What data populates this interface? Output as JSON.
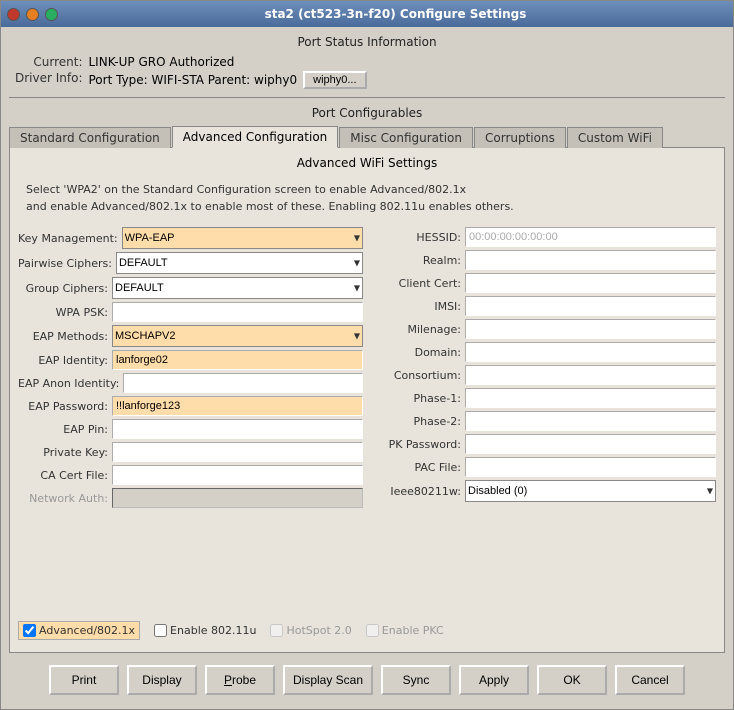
{
  "window": {
    "title": "sta2  (ct523-3n-f20) Configure Settings",
    "titlebar_buttons": [
      "close",
      "min",
      "max"
    ]
  },
  "port_status": {
    "section_title": "Port Status Information",
    "current_label": "Current:",
    "current_value": "LINK-UP GRO  Authorized",
    "driver_label": "Driver Info:",
    "driver_value": "Port Type: WIFI-STA   Parent: wiphy0",
    "wiphy_btn": "wiphy0..."
  },
  "port_configurables": {
    "section_title": "Port Configurables"
  },
  "tabs": [
    {
      "label": "Standard Configuration",
      "active": false
    },
    {
      "label": "Advanced Configuration",
      "active": true
    },
    {
      "label": "Misc Configuration",
      "active": false
    },
    {
      "label": "Corruptions",
      "active": false
    },
    {
      "label": "Custom WiFi",
      "active": false
    }
  ],
  "advanced": {
    "title": "Advanced WiFi Settings",
    "notice": "Select 'WPA2' on the Standard Configuration screen to enable Advanced/802.1x\nand enable Advanced/802.1x to enable most of these. Enabling 802.11u enables others.",
    "fields_left": [
      {
        "label": "Key Management:",
        "value": "WPA-EAP",
        "type": "select",
        "highlight": true
      },
      {
        "label": "Pairwise Ciphers:",
        "value": "DEFAULT",
        "type": "select",
        "highlight": false
      },
      {
        "label": "Group Ciphers:",
        "value": "DEFAULT",
        "type": "select",
        "highlight": false
      },
      {
        "label": "WPA PSK:",
        "value": "",
        "type": "input",
        "highlight": false
      },
      {
        "label": "EAP Methods:",
        "value": "MSCHAPV2",
        "type": "select",
        "highlight": true
      },
      {
        "label": "EAP Identity:",
        "value": "lanforge02",
        "type": "input",
        "highlight": true
      },
      {
        "label": "EAP Anon Identity:",
        "value": "",
        "type": "input",
        "highlight": false
      },
      {
        "label": "EAP Password:",
        "value": "!!lanforge123",
        "type": "input",
        "highlight": true
      },
      {
        "label": "EAP Pin:",
        "value": "",
        "type": "input",
        "highlight": false
      },
      {
        "label": "Private Key:",
        "value": "",
        "type": "input",
        "highlight": false
      },
      {
        "label": "CA Cert File:",
        "value": "",
        "type": "input",
        "highlight": false
      },
      {
        "label": "Network Auth:",
        "value": "",
        "type": "input",
        "disabled": true
      }
    ],
    "fields_right": [
      {
        "label": "HESSID:",
        "value": "00:00:00:00:00:00",
        "type": "input",
        "disabled": true
      },
      {
        "label": "Realm:",
        "value": "",
        "type": "input",
        "highlight": false
      },
      {
        "label": "Client Cert:",
        "value": "",
        "type": "input",
        "highlight": false
      },
      {
        "label": "IMSI:",
        "value": "",
        "type": "input",
        "highlight": false
      },
      {
        "label": "Milenage:",
        "value": "",
        "type": "input",
        "highlight": false
      },
      {
        "label": "Domain:",
        "value": "",
        "type": "input",
        "highlight": false
      },
      {
        "label": "Consortium:",
        "value": "",
        "type": "input",
        "highlight": false
      },
      {
        "label": "Phase-1:",
        "value": "",
        "type": "input",
        "highlight": false
      },
      {
        "label": "Phase-2:",
        "value": "",
        "type": "input",
        "highlight": false
      },
      {
        "label": "PK Password:",
        "value": "",
        "type": "input",
        "highlight": false
      },
      {
        "label": "PAC File:",
        "value": "",
        "type": "input",
        "highlight": false
      },
      {
        "label": "Ieee80211w:",
        "value": "Disabled (0)",
        "type": "select",
        "highlight": false
      }
    ],
    "checkboxes": [
      {
        "label": "Advanced/802.1x",
        "checked": true,
        "highlighted": true,
        "disabled": false
      },
      {
        "label": "Enable 802.11u",
        "checked": false,
        "highlighted": false,
        "disabled": false
      },
      {
        "label": "HotSpot 2.0",
        "checked": false,
        "highlighted": false,
        "disabled": true
      },
      {
        "label": "Enable PKC",
        "checked": false,
        "highlighted": false,
        "disabled": true
      }
    ]
  },
  "toolbar": {
    "buttons": [
      {
        "label": "Print",
        "underline": null
      },
      {
        "label": "Display",
        "underline": null
      },
      {
        "label": "Probe",
        "underline": "P"
      },
      {
        "label": "Display Scan",
        "underline": null
      },
      {
        "label": "Sync",
        "underline": null
      },
      {
        "label": "Apply",
        "underline": null
      },
      {
        "label": "OK",
        "underline": null
      },
      {
        "label": "Cancel",
        "underline": null
      }
    ]
  }
}
